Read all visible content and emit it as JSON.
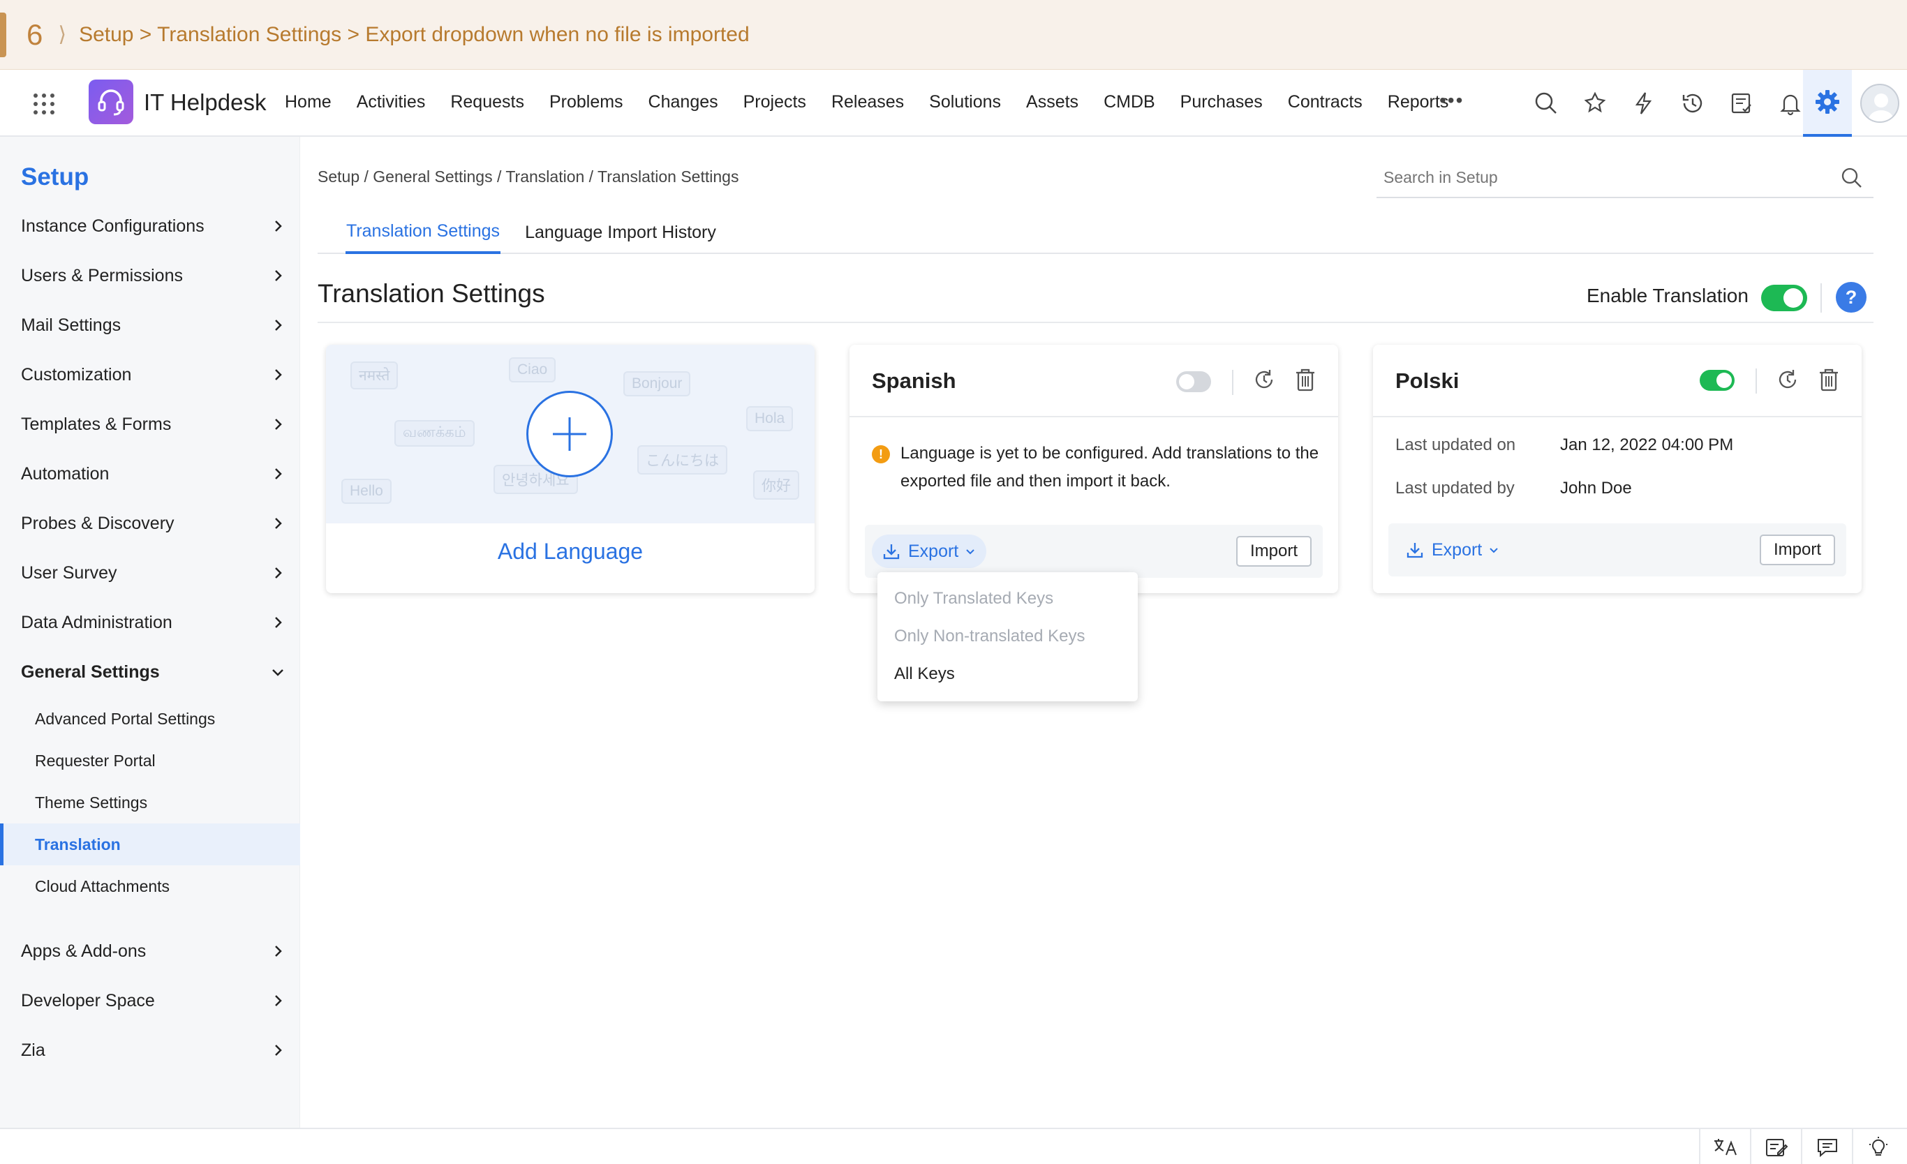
{
  "banner": {
    "step": "6",
    "path": "Setup > Translation Settings > Export dropdown when no file is imported"
  },
  "app": {
    "title": "IT Helpdesk"
  },
  "nav": {
    "links": [
      "Home",
      "Activities",
      "Requests",
      "Problems",
      "Changes",
      "Projects",
      "Releases",
      "Solutions",
      "Assets",
      "CMDB",
      "Purchases",
      "Contracts",
      "Reports"
    ],
    "more": "•••",
    "icons": [
      "search-icon",
      "magic-icon",
      "lightning-icon",
      "history-icon",
      "checklist-icon",
      "bell-icon",
      "gear-icon",
      "avatar"
    ]
  },
  "sidebar": {
    "title": "Setup",
    "items": [
      "Instance Configurations",
      "Users & Permissions",
      "Mail Settings",
      "Customization",
      "Templates & Forms",
      "Automation",
      "Probes & Discovery",
      "User Survey",
      "Data Administration"
    ],
    "expanded": {
      "label": "General Settings",
      "children": [
        "Advanced Portal Settings",
        "Requester Portal",
        "Theme Settings",
        "Translation",
        "Cloud Attachments"
      ],
      "active": "Translation"
    },
    "items_after": [
      "Apps & Add-ons",
      "Developer Space",
      "Zia"
    ]
  },
  "breadcrumb": "Setup / General Settings / Translation / Translation Settings",
  "search": {
    "placeholder": "Search in Setup"
  },
  "tabs": {
    "active": "Translation Settings",
    "other": "Language Import History"
  },
  "page": {
    "title": "Translation Settings",
    "enable_label": "Enable Translation",
    "enable_on": true,
    "help": "?"
  },
  "add_card": {
    "label": "Add Language",
    "words": [
      "नमस्ते",
      "Ciao",
      "Bonjour",
      "Hola",
      "வணக்கம்",
      "こんにちは",
      "Hello",
      "안녕하세요",
      "你好"
    ]
  },
  "spanish_card": {
    "title": "Spanish",
    "enabled": false,
    "warning": "Language is yet to be configured. Add translations to the exported file and then import it back.",
    "export_label": "Export",
    "import_label": "Import"
  },
  "export_dropdown": {
    "items": [
      {
        "label": "Only Translated Keys",
        "enabled": false
      },
      {
        "label": "Only Non-translated Keys",
        "enabled": false
      },
      {
        "label": "All Keys",
        "enabled": true
      }
    ]
  },
  "polski_card": {
    "title": "Polski",
    "enabled": true,
    "updated_on_label": "Last updated on",
    "updated_on_value": "Jan 12, 2022 04:00 PM",
    "updated_by_label": "Last updated by",
    "updated_by_value": "John Doe",
    "export_label": "Export",
    "import_label": "Import"
  },
  "colors": {
    "accent": "#2a72e2",
    "toggle_on": "#1db954",
    "warning": "#f39c12",
    "banner_text": "#b77a2e"
  },
  "bottom_icons": [
    "translate-icon",
    "notes-icon",
    "chat-icon",
    "bulb-icon"
  ]
}
